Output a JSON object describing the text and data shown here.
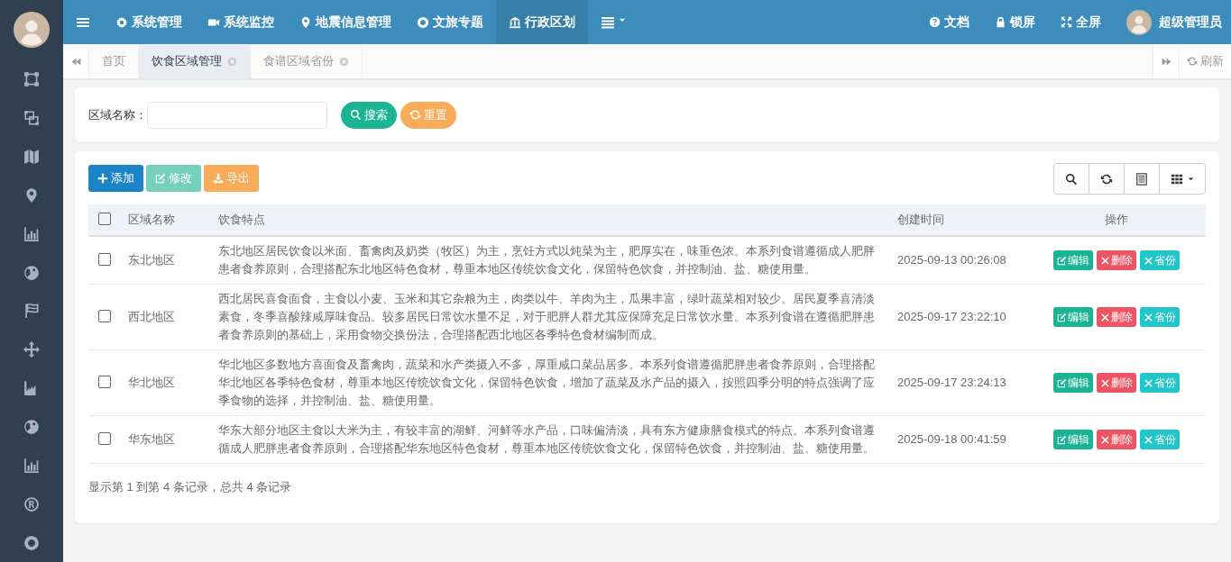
{
  "top_nav": {
    "items": [
      {
        "label": "系统管理",
        "selected": false
      },
      {
        "label": "系统监控",
        "selected": false
      },
      {
        "label": "地震信息管理",
        "selected": false
      },
      {
        "label": "文旅专题",
        "selected": false
      },
      {
        "label": "行政区划",
        "selected": true
      }
    ],
    "right_items": [
      {
        "label": "文档"
      },
      {
        "label": "锁屏"
      },
      {
        "label": "全屏"
      }
    ],
    "user_name": "超级管理员"
  },
  "page_tabs": {
    "items": [
      {
        "label": "首页",
        "selected": false,
        "closable": false
      },
      {
        "label": "饮食区域管理",
        "selected": true,
        "closable": true
      },
      {
        "label": "食谱区域省份",
        "selected": false,
        "closable": true
      }
    ],
    "refresh_label": "刷新"
  },
  "search": {
    "label": "区域名称：",
    "buttons": [
      {
        "label": "搜索",
        "kind": "search"
      },
      {
        "label": "重置",
        "kind": "reset"
      }
    ]
  },
  "toolbar": {
    "buttons": [
      {
        "label": "添加",
        "kind": "add",
        "disabled": false
      },
      {
        "label": "修改",
        "kind": "edit",
        "disabled": true
      },
      {
        "label": "导出",
        "kind": "export",
        "disabled": false
      }
    ]
  },
  "table": {
    "select_all_checked": false,
    "columns": [
      "区域名称",
      "饮食特点",
      "创建时间",
      "操作"
    ],
    "rows": [
      {
        "checked": false,
        "region": "东北地区",
        "features": "东北地区居民饮食以米面、畜禽肉及奶类（牧区）为主，烹饪方式以炖菜为主，肥厚实在，味重色浓。本系列食谱遵循成人肥胖患者食养原则，合理搭配东北地区特色食材，尊重本地区传统饮食文化，保留特色饮食，并控制油、盐、糖使用量。",
        "created": "2025-09-13 00:26:08",
        "actions": [
          {
            "label": "编辑",
            "kind": "edit"
          },
          {
            "label": "删除",
            "kind": "delete"
          },
          {
            "label": "省份",
            "kind": "province"
          }
        ]
      },
      {
        "checked": false,
        "region": "西北地区",
        "features": "西北居民喜食面食，主食以小麦、玉米和其它杂粮为主，肉类以牛、羊肉为主，瓜果丰富，绿叶蔬菜相对较少。居民夏季喜清淡素食，冬季喜酸辣咸厚味食品。较多居民日常饮水量不足，对于肥胖人群尤其应保障充足日常饮水量。本系列食谱在遵循肥胖患者食养原则的基础上，采用食物交换份法，合理搭配西北地区各季特色食材编制而成。",
        "created": "2025-09-17 23:22:10",
        "actions": [
          {
            "label": "编辑",
            "kind": "edit"
          },
          {
            "label": "删除",
            "kind": "delete"
          },
          {
            "label": "省份",
            "kind": "province"
          }
        ]
      },
      {
        "checked": false,
        "region": "华北地区",
        "features": "华北地区多数地方喜面食及畜禽肉，蔬菜和水产类摄入不多，厚重咸口菜品居多。本系列食谱遵循肥胖患者食养原则，合理搭配华北地区各季特色食材，尊重本地区传统饮食文化，保留特色饮食，增加了蔬菜及水产品的摄入，按照四季分明的特点强调了应季食物的选择，并控制油、盐、糖使用量。",
        "created": "2025-09-17 23:24:13",
        "actions": [
          {
            "label": "编辑",
            "kind": "edit"
          },
          {
            "label": "删除",
            "kind": "delete"
          },
          {
            "label": "省份",
            "kind": "province"
          }
        ]
      },
      {
        "checked": false,
        "region": "华东地区",
        "features": "华东大部分地区主食以大米为主，有较丰富的湖鲜、河鲜等水产品，口味偏清淡，具有东方健康膳食模式的特点。本系列食谱遵循成人肥胖患者食养原则，合理搭配华东地区特色食材，尊重本地区传统饮食文化，保留特色饮食，并控制油、盐、糖使用量。",
        "created": "2025-09-18 00:41:59",
        "actions": [
          {
            "label": "编辑",
            "kind": "edit"
          },
          {
            "label": "删除",
            "kind": "delete"
          },
          {
            "label": "省份",
            "kind": "province"
          }
        ]
      }
    ]
  },
  "pagination_info": "显示第 1 到第 4 条记录，总共 4 条记录"
}
